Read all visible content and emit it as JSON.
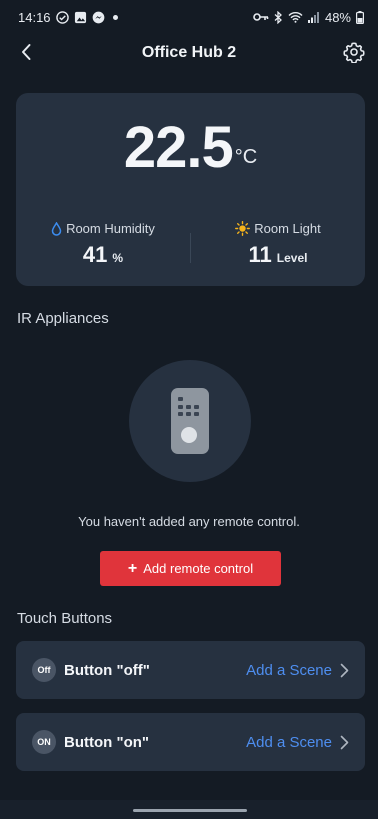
{
  "status_bar": {
    "time": "14:16",
    "battery": "48%"
  },
  "header": {
    "title": "Office Hub 2"
  },
  "sensor": {
    "temperature": "22.5",
    "temperature_unit": "°C",
    "humidity_label": "Room Humidity",
    "humidity_value": "41",
    "humidity_unit": "%",
    "light_label": "Room Light",
    "light_value": "11",
    "light_unit": "Level"
  },
  "ir": {
    "section_title": "IR Appliances",
    "empty_text": "You haven't added any remote control.",
    "add_button_label": "Add remote control"
  },
  "touch": {
    "section_title": "Touch Buttons",
    "buttons": [
      {
        "badge": "Off",
        "name": "Button \"off\"",
        "action": "Add a Scene"
      },
      {
        "badge": "ON",
        "name": "Button \"on\"",
        "action": "Add a Scene"
      }
    ]
  },
  "colors": {
    "background": "#141b24",
    "card": "#263140",
    "accent_red": "#e0343b",
    "link_blue": "#4e8ef0"
  }
}
